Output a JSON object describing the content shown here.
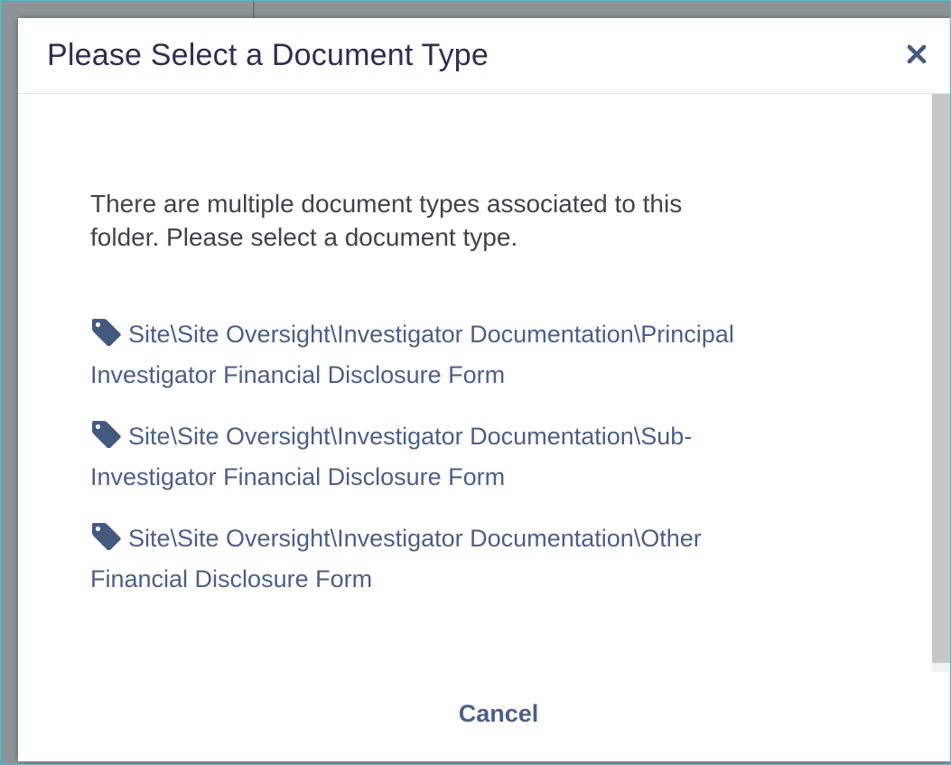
{
  "dialog": {
    "title": "Please Select a Document Type",
    "intro_line1": "There are multiple document types associated to this",
    "intro_line2": "folder. Please select a document type.",
    "options": [
      {
        "line1": "Site\\Site Oversight\\Investigator Documentation\\Principal",
        "line2": "Investigator Financial Disclosure Form"
      },
      {
        "line1": "Site\\Site Oversight\\Investigator Documentation\\Sub-",
        "line2": "Investigator Financial Disclosure Form"
      },
      {
        "line1": "Site\\Site Oversight\\Investigator Documentation\\Other",
        "line2": "Financial Disclosure Form"
      }
    ],
    "cancel_label": "Cancel",
    "icons": {
      "close": "close-icon",
      "tag": "tag-icon"
    }
  },
  "colors": {
    "title": "#2b2f52",
    "link": "#4b5f87",
    "text": "#3f4448",
    "border": "#56b9c7"
  }
}
